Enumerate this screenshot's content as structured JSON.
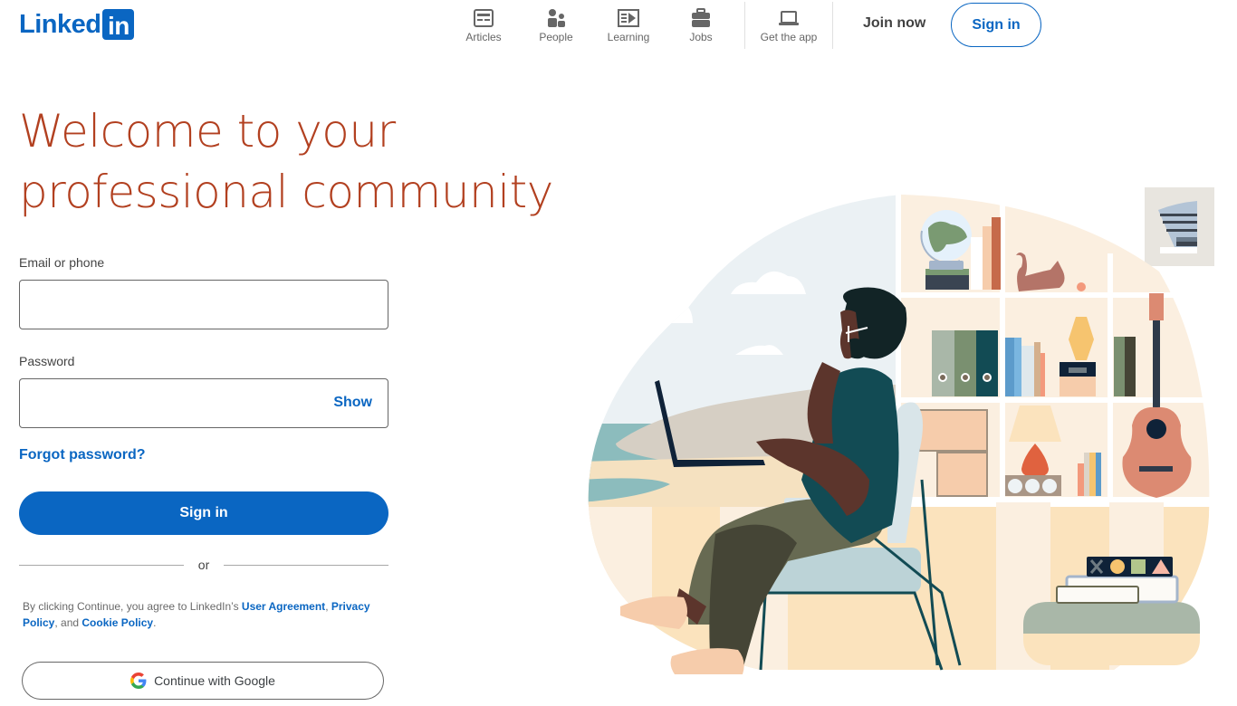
{
  "header": {
    "logo": {
      "text": "Linked",
      "box_text": "in"
    },
    "nav": [
      {
        "label": "Articles",
        "icon": "articles-icon"
      },
      {
        "label": "People",
        "icon": "people-icon"
      },
      {
        "label": "Learning",
        "icon": "learning-icon"
      },
      {
        "label": "Jobs",
        "icon": "jobs-icon"
      },
      {
        "label": "Get the app",
        "icon": "laptop-icon"
      }
    ],
    "join_now": "Join now",
    "sign_in": "Sign in"
  },
  "hero": {
    "headline_line1": "Welcome to your",
    "headline_line2": "professional community"
  },
  "form": {
    "email_label": "Email or phone",
    "email_value": "",
    "email_placeholder": "",
    "password_label": "Password",
    "password_value": "",
    "password_placeholder": "",
    "show_label": "Show",
    "forgot_label": "Forgot password?",
    "sign_in_label": "Sign in",
    "or_label": "or",
    "legal": {
      "prefix": "By clicking Continue, you agree to LinkedIn’s ",
      "user_agreement": "User Agreement",
      "comma": ", ",
      "privacy_policy": "Privacy Policy",
      "and": ", and ",
      "cookie_policy": "Cookie Policy",
      "period": "."
    },
    "google_label": "Continue with Google"
  },
  "colors": {
    "brand": "#0a66c2",
    "headline": "#b24020",
    "nav_text": "#666666"
  },
  "illustration": {
    "description": "Person sitting on a chair with a laptop in front of a bookshelf and seaside window"
  }
}
